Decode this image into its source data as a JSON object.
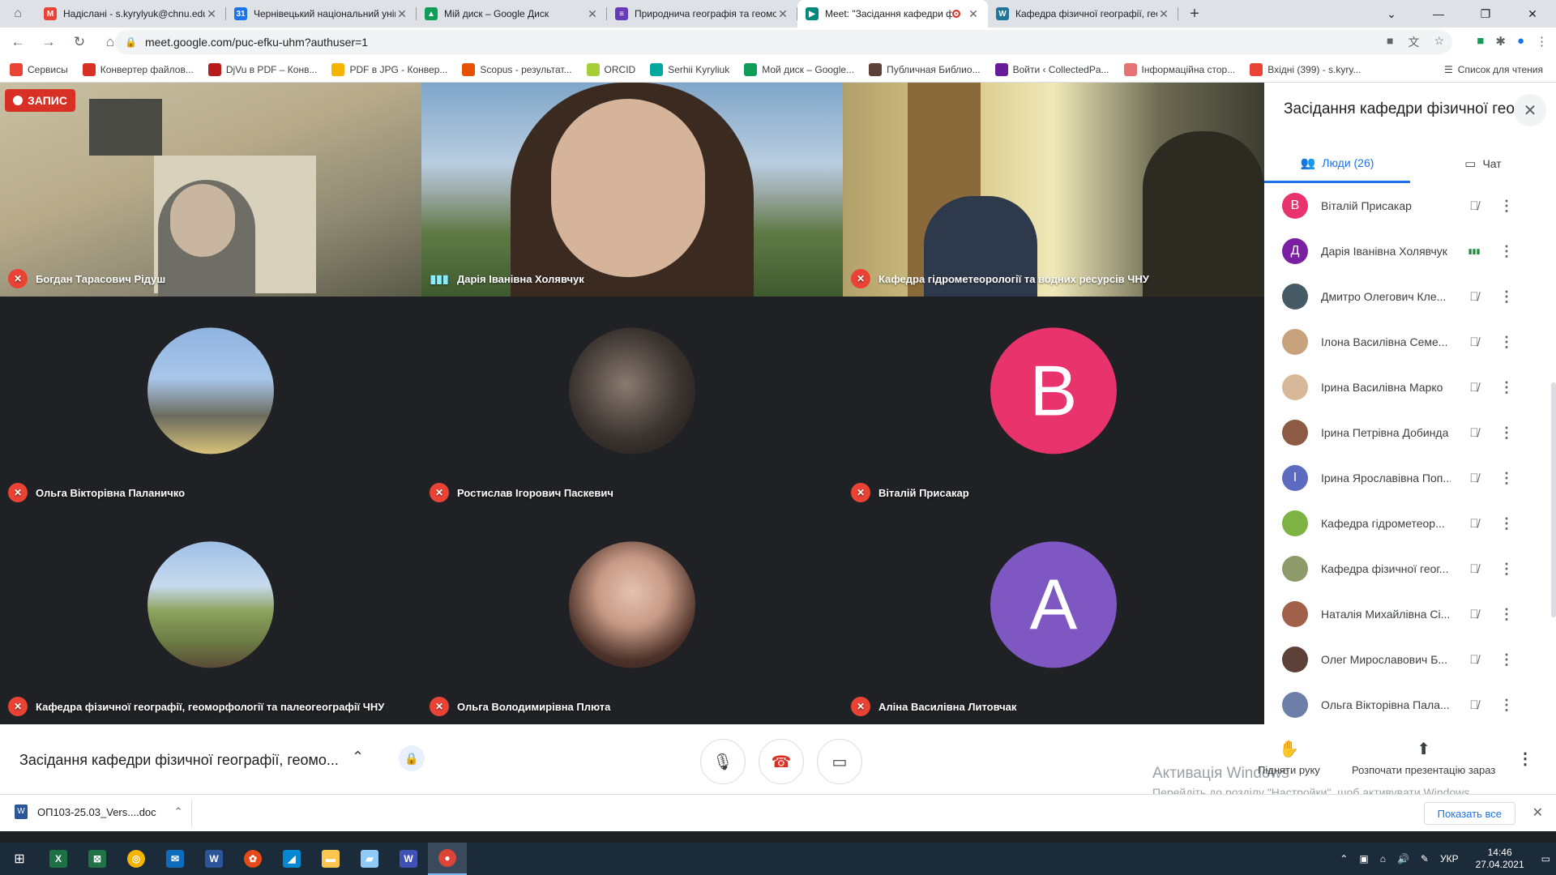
{
  "browser": {
    "tabs": [
      {
        "title": "Надіслані - s.kyrylyuk@chnu.edu.ua",
        "fav": "M",
        "color": "#ea4335"
      },
      {
        "title": "Чернівецький національний університет",
        "fav": "31",
        "color": "#1a73e8"
      },
      {
        "title": "Мій диск – Google Диск",
        "fav": "▲",
        "color": "#0f9d58"
      },
      {
        "title": "Природнича географія та геоморфологія",
        "fav": "≡",
        "color": "#673ab7"
      },
      {
        "title": "Meet: \"Засідання кафедри фізичної",
        "fav": "▶",
        "color": "#00897b"
      },
      {
        "title": "Кафедра фізичної географії, геоморфології",
        "fav": "W",
        "color": "#21759b"
      }
    ],
    "url": "meet.google.com/puc-efku-uhm?authuser=1",
    "bookmarks": [
      {
        "label": "Сервисы",
        "color": "#ea4335"
      },
      {
        "label": "Конвертер файлов...",
        "color": "#d93025"
      },
      {
        "label": "DjVu в PDF – Конв...",
        "color": "#b71c1c"
      },
      {
        "label": "PDF в JPG - Конвер...",
        "color": "#f4b400"
      },
      {
        "label": "Scopus - результат...",
        "color": "#e65100"
      },
      {
        "label": "ORCID",
        "color": "#a6ce39"
      },
      {
        "label": "Serhii Kyryliuk",
        "color": "#00a99d"
      },
      {
        "label": "Мой диск – Google...",
        "color": "#0f9d58"
      },
      {
        "label": "Публичная Библио...",
        "color": "#5d4037"
      },
      {
        "label": "Войти ‹ CollectedPa...",
        "color": "#6a1b9a"
      },
      {
        "label": "Інформаційна стор...",
        "color": "#e57373"
      },
      {
        "label": "Вхідні (399) - s.kyry...",
        "color": "#ea4335"
      }
    ],
    "reading_list": "Список для чтения"
  },
  "meet": {
    "recording_label": "ЗАПИС",
    "tiles": [
      {
        "name": "Богдан Тарасович Рідуш",
        "status": "muted"
      },
      {
        "name": "Дарія Іванівна Холявчук",
        "status": "speaking"
      },
      {
        "name": "Кафедра гідрометеорології та водних ресурсів ЧНУ",
        "status": "muted"
      },
      {
        "name": "Ольга Вікторівна Паланичко",
        "status": "muted"
      },
      {
        "name": "Ростислав Ігорович Паскевич",
        "status": "muted"
      },
      {
        "name": "Віталій Присакар",
        "status": "muted",
        "initial": "В",
        "color": "#e8336d"
      },
      {
        "name": "Кафедра фізичної географії, геоморфології та палеогеографії ЧНУ",
        "status": "muted"
      },
      {
        "name": "Ольга Володимирівна Плюта",
        "status": "muted"
      },
      {
        "name": "Аліна Василівна Литовчак",
        "status": "muted",
        "initial": "А",
        "color": "#7e57c2"
      }
    ],
    "panel": {
      "title": "Засідання кафедри фізичної гео...",
      "people_tab": "Люди (26)",
      "chat_tab": "Чат",
      "people": [
        {
          "name": "Віталій Присакар",
          "initial": "В",
          "color": "#e8336d",
          "mic": "off"
        },
        {
          "name": "Дарія Іванівна Холявчук",
          "initial": "Д",
          "color": "#7b1fa2",
          "mic": "on"
        },
        {
          "name": "Дмитро Олегович Кле...",
          "initial": "",
          "color": "#455a64",
          "mic": "off"
        },
        {
          "name": "Ілона Василівна Семе...",
          "initial": "",
          "color": "#c8a27c",
          "mic": "off"
        },
        {
          "name": "Ірина Василівна Марко",
          "initial": "",
          "color": "#d7b899",
          "mic": "off"
        },
        {
          "name": "Ірина Петрівна Добинда",
          "initial": "",
          "color": "#8d5a44",
          "mic": "off"
        },
        {
          "name": "Ірина Ярославівна Поп...",
          "initial": "І",
          "color": "#5c6bc0",
          "mic": "off"
        },
        {
          "name": "Кафедра гідрометеор...",
          "initial": "",
          "color": "#7cb342",
          "mic": "off"
        },
        {
          "name": "Кафедра фізичної геог...",
          "initial": "",
          "color": "#8d9a6a",
          "mic": "off"
        },
        {
          "name": "Наталія Михайлівна Сі...",
          "initial": "",
          "color": "#a1604a",
          "mic": "off"
        },
        {
          "name": "Олег Мирославович Б...",
          "initial": "",
          "color": "#5d4037",
          "mic": "off"
        },
        {
          "name": "Ольга Вікторівна Пала...",
          "initial": "",
          "color": "#6d7fa8",
          "mic": "off"
        }
      ]
    },
    "bottom": {
      "meeting_name": "Засідання кафедри фізичної географії, геомо...",
      "raise_hand": "Підняти руку",
      "present": "Розпочати презентацію зараз"
    },
    "windows_activation": {
      "title": "Активація Windows",
      "subtitle": "Перейдіть до розділу \"Настройки\", щоб активувати Windows."
    }
  },
  "downloads": {
    "file": "ОП103-25.03_Vers....doc",
    "show_all": "Показать все"
  },
  "taskbar": {
    "lang": "УКР",
    "time": "14:46",
    "date": "27.04.2021"
  }
}
